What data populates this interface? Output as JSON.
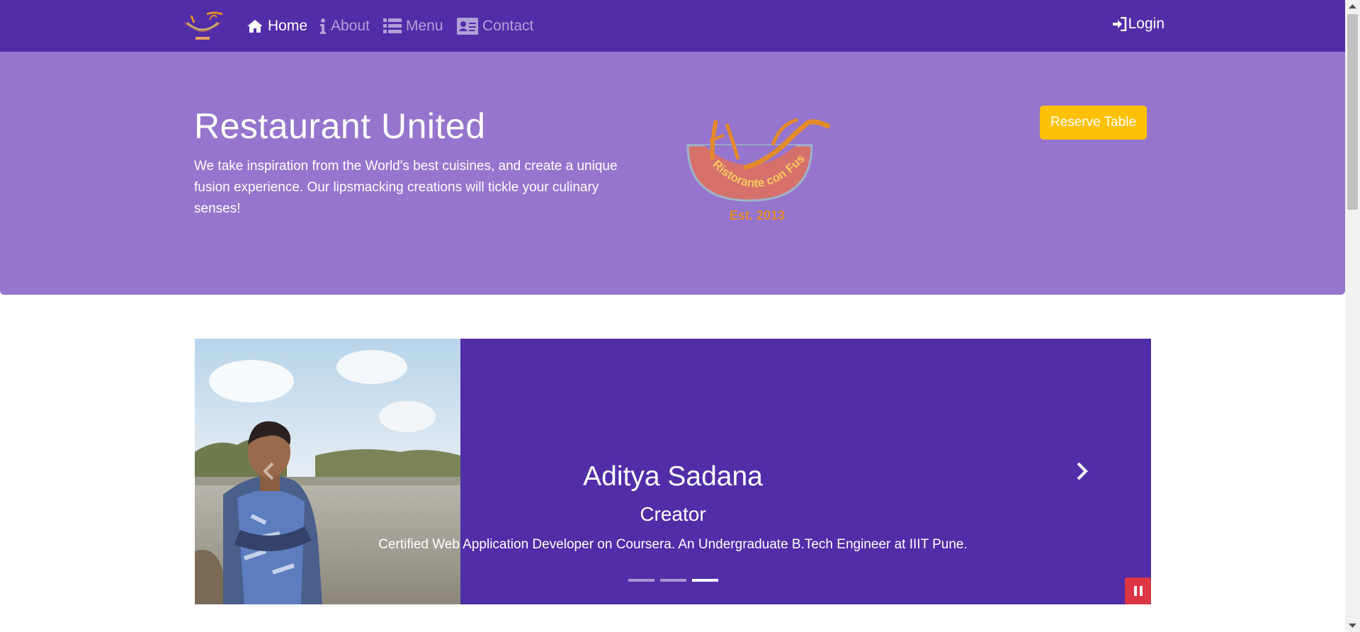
{
  "nav": {
    "home": "Home",
    "about": "About",
    "menu": "Menu",
    "contact": "Contact",
    "login": "Login",
    "active": "home"
  },
  "jumbotron": {
    "title": "Restaurant United",
    "description": "We take inspiration from the World's best cuisines, and create a unique fusion experience. Our lipsmacking creations will tickle your culinary senses!",
    "reserve_label": "Reserve Table",
    "logo_text": "Ristorante con Fusion",
    "logo_est": "Est. 2013"
  },
  "carousel": {
    "name": "Aditya Sadana",
    "role": "Creator",
    "description": "Certified Web Application Developer on Coursera. An Undergraduate B.Tech Engineer at IIIT Pune.",
    "slide_count": 3,
    "active_slide": 3
  },
  "icons": {
    "home": "home-icon",
    "about": "info-icon",
    "menu": "list-icon",
    "contact": "address-card-icon",
    "login": "sign-in-icon",
    "prev": "chevron-left-icon",
    "next": "chevron-right-icon",
    "pause": "pause-icon"
  },
  "colors": {
    "primary": "#512DA8",
    "jumbotron": "#9575CD",
    "reserve": "#FFC107",
    "pause": "#DC3545"
  }
}
